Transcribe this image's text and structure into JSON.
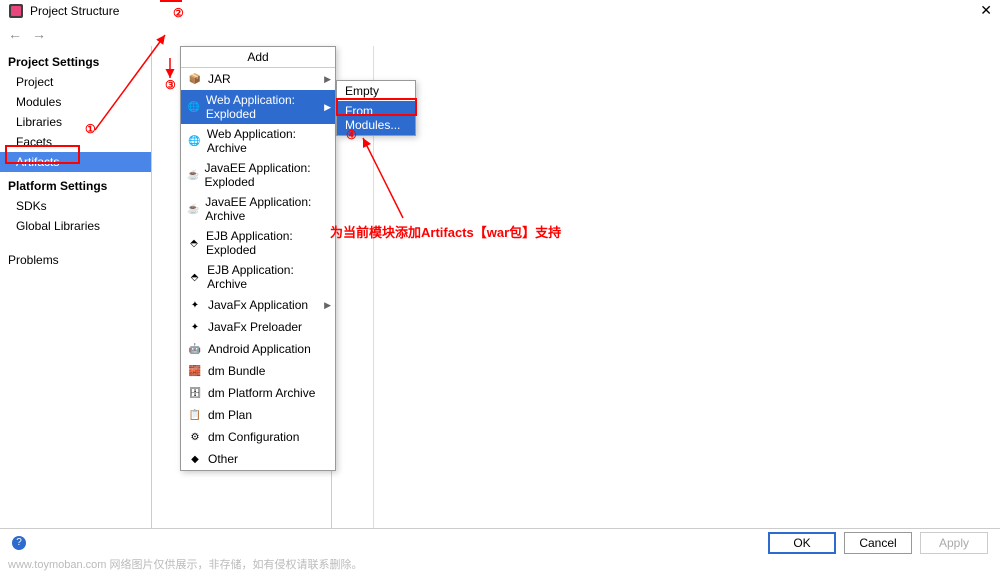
{
  "window": {
    "title": "Project Structure"
  },
  "toolbar": {
    "title": "Add"
  },
  "sidebar": {
    "section1": "Project Settings",
    "items1": [
      "Project",
      "Modules",
      "Libraries",
      "Facets",
      "Artifacts"
    ],
    "selected1": "Artifacts",
    "section2": "Platform Settings",
    "items2": [
      "SDKs",
      "Global Libraries"
    ],
    "section3": "Problems"
  },
  "popup": {
    "header": "Add",
    "items": [
      {
        "label": "JAR",
        "icon": "jar-icon",
        "submenu": true
      },
      {
        "label": "Web Application: Exploded",
        "icon": "web-icon",
        "submenu": true,
        "selected": true
      },
      {
        "label": "Web Application: Archive",
        "icon": "web-icon"
      },
      {
        "label": "JavaEE Application: Exploded",
        "icon": "javaee-icon"
      },
      {
        "label": "JavaEE Application: Archive",
        "icon": "javaee-icon"
      },
      {
        "label": "EJB Application: Exploded",
        "icon": "ejb-icon"
      },
      {
        "label": "EJB Application: Archive",
        "icon": "ejb-icon"
      },
      {
        "label": "JavaFx Application",
        "icon": "javafx-icon",
        "submenu": true
      },
      {
        "label": "JavaFx Preloader",
        "icon": "javafx-icon"
      },
      {
        "label": "Android Application",
        "icon": "android-icon"
      },
      {
        "label": "dm Bundle",
        "icon": "bundle-icon"
      },
      {
        "label": "dm Platform Archive",
        "icon": "archive-icon"
      },
      {
        "label": "dm Plan",
        "icon": "plan-icon"
      },
      {
        "label": "dm Configuration",
        "icon": "config-icon"
      },
      {
        "label": "Other",
        "icon": "other-icon"
      }
    ]
  },
  "submenu": {
    "items": [
      "Empty",
      "From Modules..."
    ],
    "selected": "From Modules..."
  },
  "footer": {
    "ok": "OK",
    "cancel": "Cancel",
    "apply": "Apply"
  },
  "annotations": {
    "n1": "①",
    "n2": "②",
    "n3": "③",
    "n4": "④",
    "text": "为当前模块添加Artifacts【war包】支持"
  },
  "watermark": "www.toymoban.com 网络图片仅供展示，非存储，如有侵权请联系删除。",
  "icons": {
    "jar": "📦",
    "web": "🌐",
    "javaee": "☕",
    "ejb": "⬘",
    "javafx": "✦",
    "android": "🤖",
    "bundle": "🧱",
    "archive": "🗄",
    "plan": "📋",
    "config": "⚙",
    "other": "◆",
    "app": "▣"
  }
}
